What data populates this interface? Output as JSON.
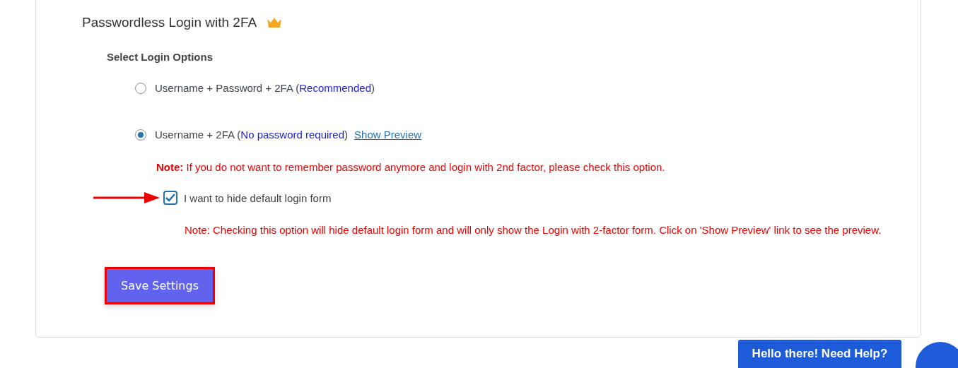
{
  "panel": {
    "title": "Passwordless Login with 2FA",
    "section_label": "Select Login Options",
    "options": [
      {
        "text": "Username + Password + 2FA (",
        "highlight": "Recommended",
        "suffix": ")",
        "selected": false
      },
      {
        "text": "Username + 2FA (",
        "highlight": "No password required",
        "suffix": ")",
        "selected": true,
        "link": "Show Preview"
      }
    ],
    "note": "**Note:** If you do not want to remember password anymore and login with 2nd factor, please check this option.",
    "checkbox": {
      "label": "I want to hide default login form",
      "checked": true
    },
    "checkbox_note": "Note: Checking this option will hide default login form and will only show the Login with 2-factor form. Click on 'Show Preview' link to see the preview.",
    "save_button": "Save Settings"
  },
  "chat": {
    "button": "Hello there! Need Help?"
  }
}
